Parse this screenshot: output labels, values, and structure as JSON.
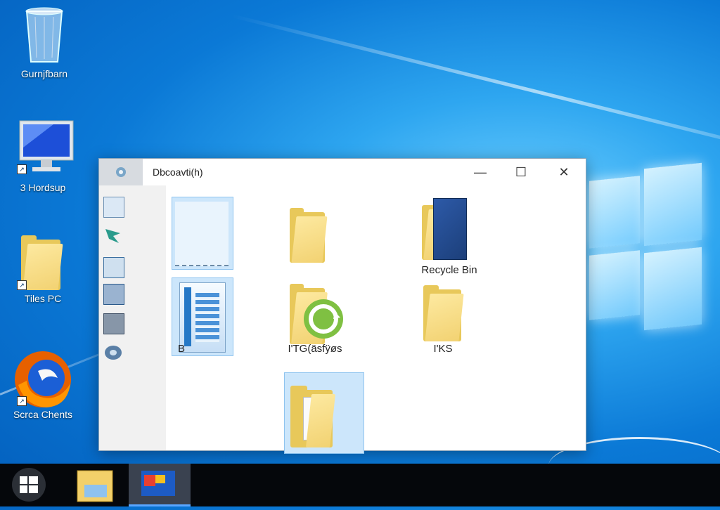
{
  "desktop": {
    "icons": [
      {
        "label": "Gurnjfbarn",
        "icon": "recycle-bin-icon"
      },
      {
        "label": "3 Hordsup",
        "icon": "computer-icon"
      },
      {
        "label": "Tiles PC",
        "icon": "folder-icon"
      },
      {
        "label": "Scrca Chents",
        "icon": "firefox-icon"
      }
    ]
  },
  "window": {
    "title": "Dbcoavti(h)",
    "controls": {
      "minimize": "—",
      "maximize": "☐",
      "close": "✕"
    },
    "items": [
      {
        "caption": "",
        "icon": "blank-file-icon"
      },
      {
        "caption": "",
        "icon": "folder-icon"
      },
      {
        "caption": "Recycle Bin",
        "icon": "folder-with-document-icon"
      },
      {
        "caption": "B",
        "icon": "document-image-icon"
      },
      {
        "caption": "I'TG(äsfÿøs",
        "icon": "folder-sync-icon"
      },
      {
        "caption": "I'KS",
        "icon": "folder-icon"
      },
      {
        "caption": "",
        "icon": "folder-documents-icon"
      }
    ]
  },
  "taskbar": {
    "start_icon": "windows-start-icon",
    "buttons": [
      "file-explorer-icon",
      "active-window-icon"
    ]
  },
  "colors": {
    "accent": "#0b79d6",
    "folder": "#f2d272",
    "selection": "#cce6fb"
  }
}
